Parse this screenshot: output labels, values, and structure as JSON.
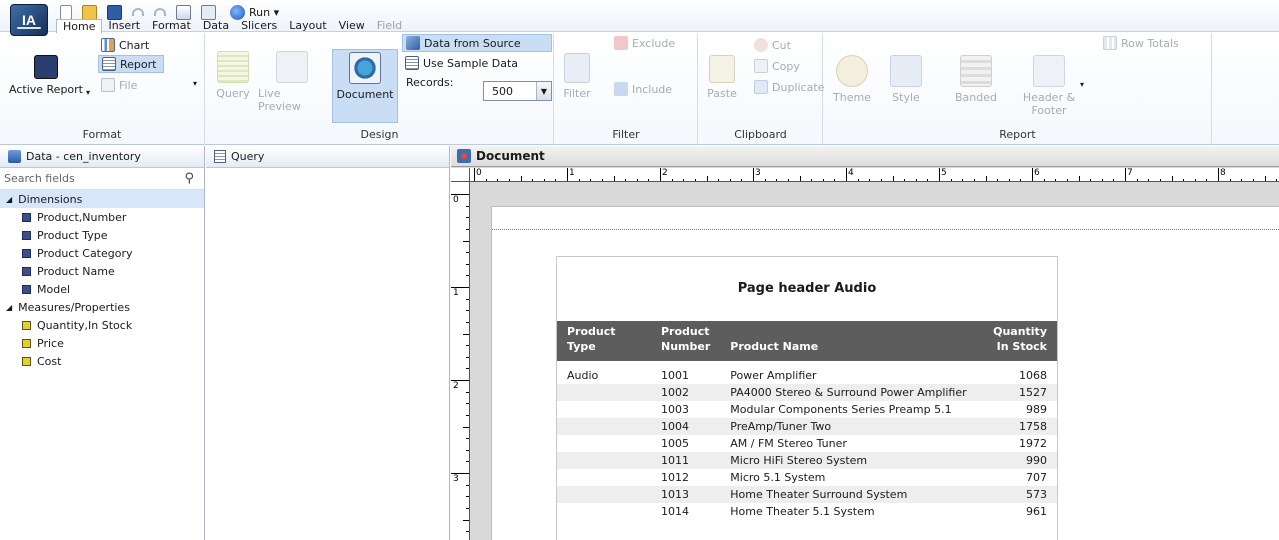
{
  "app": {
    "logo_text": "IA"
  },
  "quick_access": {
    "run_label": "Run ▾"
  },
  "menu_tabs": [
    "Home",
    "Insert",
    "Format",
    "Data",
    "Slicers",
    "Layout",
    "View",
    "Field"
  ],
  "ribbon": {
    "format_group": {
      "label": "Format",
      "active_report": "Active Report",
      "chart": "Chart",
      "report": "Report",
      "file": "File"
    },
    "design_group": {
      "label": "Design",
      "query": "Query",
      "live_preview": "Live Preview",
      "document": "Document",
      "data_from_source": "Data from Source",
      "use_sample_data": "Use Sample Data",
      "records_label": "Records:",
      "records_value": "500"
    },
    "filter_group": {
      "label": "Filter",
      "filter": "Filter",
      "exclude": "Exclude",
      "include": "Include"
    },
    "clipboard_group": {
      "label": "Clipboard",
      "paste": "Paste",
      "cut": "Cut",
      "copy": "Copy",
      "duplicate": "Duplicate"
    },
    "report_group": {
      "label": "Report",
      "theme": "Theme",
      "style": "Style",
      "banded": "Banded",
      "header_footer_1": "Header &",
      "header_footer_2": "Footer",
      "row_totals": "Row Totals"
    }
  },
  "data_panel": {
    "title": "Data - cen_inventory",
    "search_placeholder": "Search fields",
    "dimensions_label": "Dimensions",
    "dimensions": [
      "Product,Number",
      "Product Type",
      "Product Category",
      "Product Name",
      "Model"
    ],
    "measures_label": "Measures/Properties",
    "measures": [
      "Quantity,In Stock",
      "Price",
      "Cost"
    ]
  },
  "query_panel": {
    "title": "Query"
  },
  "document_panel": {
    "title": "Document",
    "ruler_h_labels": [
      "0",
      "1",
      "2",
      "3",
      "4",
      "5",
      "6",
      "7",
      "8"
    ],
    "ruler_v_labels": [
      "0",
      "1",
      "2",
      "3"
    ]
  },
  "report": {
    "page_header": "Page header Audio",
    "columns": {
      "product_type": "Product Type",
      "product_number_1": "Product",
      "product_number_2": "Number",
      "product_name": "Product Name",
      "quantity_1": "Quantity",
      "quantity_2": "In Stock"
    },
    "rows": [
      {
        "type": "Audio",
        "number": "1001",
        "name": "Power Amplifier",
        "qty": "1068"
      },
      {
        "type": "",
        "number": "1002",
        "name": "PA4000 Stereo & Surround Power Amplifier",
        "qty": "1527"
      },
      {
        "type": "",
        "number": "1003",
        "name": "Modular Components Series Preamp 5.1",
        "qty": "989"
      },
      {
        "type": "",
        "number": "1004",
        "name": "PreAmp/Tuner Two",
        "qty": "1758"
      },
      {
        "type": "",
        "number": "1005",
        "name": "AM / FM Stereo Tuner",
        "qty": "1972"
      },
      {
        "type": "",
        "number": "1011",
        "name": "Micro HiFi Stereo System",
        "qty": "990"
      },
      {
        "type": "",
        "number": "1012",
        "name": "Micro 5.1 System",
        "qty": "707"
      },
      {
        "type": "",
        "number": "1013",
        "name": "Home Theater Surround System",
        "qty": "573"
      },
      {
        "type": "",
        "number": "1014",
        "name": "Home Theater 5.1 System",
        "qty": "961"
      }
    ]
  }
}
